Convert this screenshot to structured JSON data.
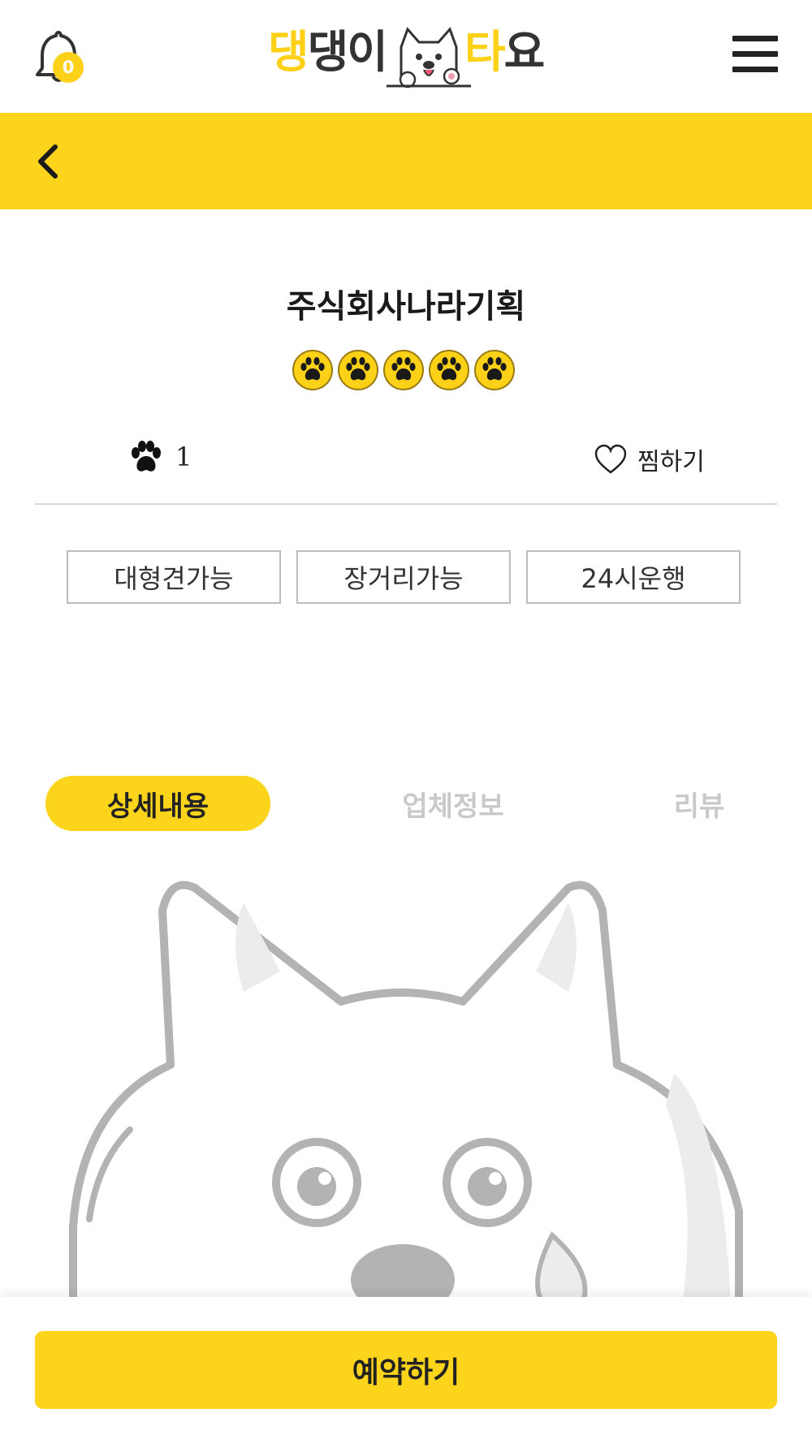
{
  "header": {
    "notification_count": "0",
    "logo": {
      "part1": "댕",
      "part2": "댕이",
      "part3": "타",
      "part4": "요"
    }
  },
  "company": {
    "name": "주식회사나라기획",
    "rating": 5,
    "paw_count": "1",
    "like_label": "찜하기"
  },
  "features": [
    "대형견가능",
    "장거리가능",
    "24시운행"
  ],
  "tabs": [
    {
      "label": "상세내용",
      "active": true
    },
    {
      "label": "업체정보",
      "active": false
    },
    {
      "label": "리뷰",
      "active": false
    }
  ],
  "cta": {
    "reserve_label": "예약하기"
  },
  "colors": {
    "accent": "#fcd41c",
    "badge": "#fcd117",
    "inactive_tab": "#c9c9c9"
  },
  "icons": [
    "bell-icon",
    "menu-icon",
    "back-arrow-icon",
    "paw-icon",
    "heart-icon",
    "dog-illustration"
  ]
}
